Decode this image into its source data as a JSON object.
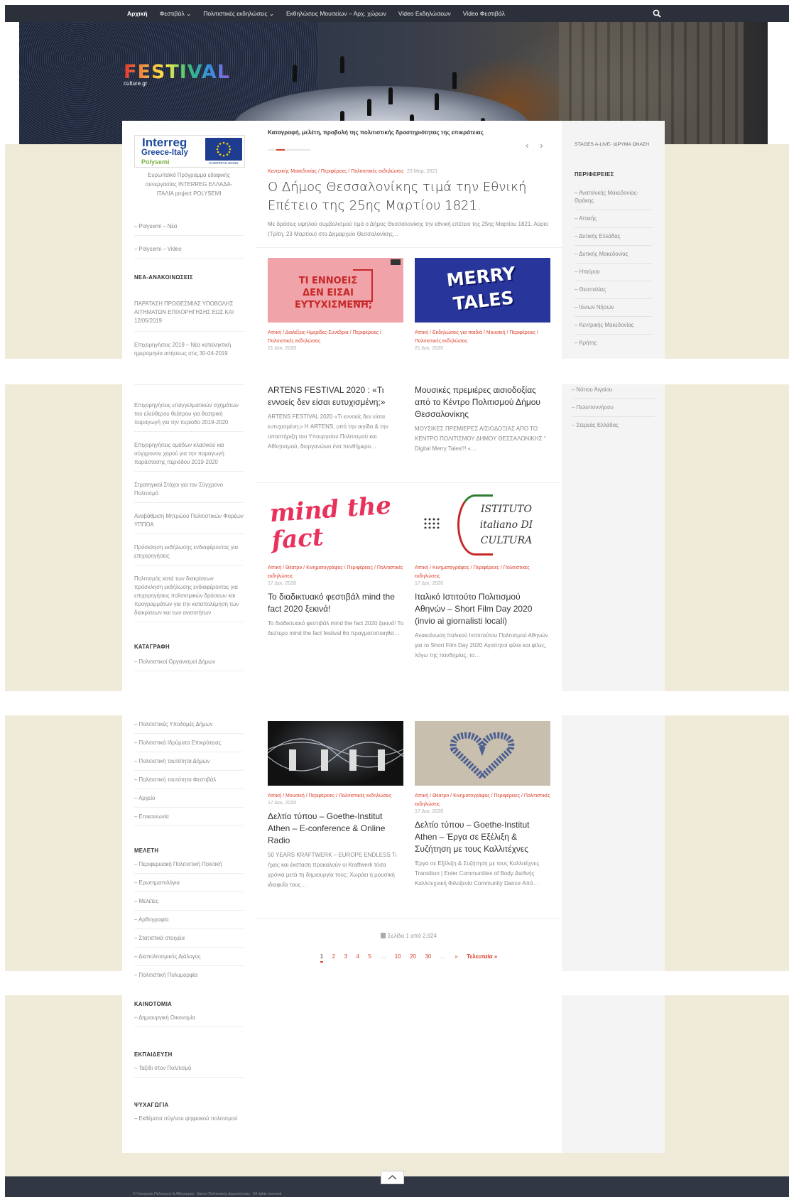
{
  "nav": {
    "items": [
      "Αρχική",
      "Φεστιβάλ ⌄",
      "Πολιτιστικές εκδηλώσεις ⌄",
      "Εκθηλώσεις Μουσείων – Αρχ. χώρων",
      "Video Εκδηλώσεων",
      "Video Φεστιβάλ"
    ]
  },
  "logo": {
    "title": "FESTIVAL",
    "sub": "culture.gr"
  },
  "tagline": "Καταγραφή, μελέτη, προβολή της πολιτιστικής δραστηριότητας της επικράτειας",
  "interreg": {
    "line1": "Interreg",
    "line2": "Greece-Italy",
    "line3": "Polysemi",
    "eu": "EUROPEAN UNION",
    "caption": "Ευρωπαϊκό Πρόγραμμα εδαφικής συνεργασίας INTERREG ΕΛΛΑΔΑ-ΙΤΑΛΙΑ project POLYSEMI"
  },
  "left": {
    "polysemi": [
      "– Polysemi – Νέα",
      "– Polysemi – Video"
    ],
    "news_heading": "ΝΕΑ-ΑΝΑΚΟΙΝΩΣΕΙΣ",
    "news_a": [
      "ΠΑΡΑΤΑΣΗ ΠΡΟΘΕΣΜΙΑΣ ΥΠΟΒΟΛΗΣ ΑΙΤΗΜΑΤΩΝ ΕΠΙΧΟΡΗΓΗΣΗΣ ΕΩΣ ΚΑΙ 12/05/2019",
      "Επιχορηγήσεις 2019 – Νέα καταληκτική ημερομηνία αιτήσεως στις 30-04-2019"
    ],
    "news_b": [
      "Επιχορηγήσεις επαγγελματικών σχημάτων του ελεύθερου θεάτρου για θεατρική παραγωγή για την περίοδο 2019-2020",
      "Επιχορηγήσεις ομάδων κλασικού και σύγχρονου χορού για την παραγωγή παράστασης περιόδου 2019-2020",
      "Στρατηγικοί Στόχοι για τον Σύγχρονο Πολιτισμό",
      "Αναβάθμιση Μητρώου Πολιτιστικών Φορέων ΥΠΠΟΑ",
      "Πρόσκληση εκδήλωσης ενδιαφέροντος για επιχορηγήσεις",
      "Πολιτισμός κατά των διακρίσεων πρόσκληση εκδήλωσης ενδιαφέροντος για επιχορηγήσεις πολιτισμικών δράσεων και προγραμμάτων για την καταπολέμηση των διακρίσεων και των ανισοτήτων"
    ],
    "katagrafi_heading": "ΚΑΤΑΓΡΑΦΗ",
    "katagrafi_a": [
      "– Πολιτιστικοί Οργανισμοί Δήμων"
    ],
    "katagrafi_b": [
      "– Πολιτιστικές Υποδομές Δήμων",
      "– Πολιτιστικά Ιδρύματα Επικράτειας",
      "– Πολιτιστική ταυτότητα Δήμων",
      "– Πολιτιστική ταυτότητα Φεστιβάλ",
      "– Αρχείο",
      "– Επικοινωνία"
    ],
    "meleti_heading": "ΜΕΛΕΤΗ",
    "meleti": [
      "– Περιφερειακή Πολιτιστική Πολιτική",
      "– Ερωτηματολόγια",
      "– Μελέτες",
      "– Αρθογραφία",
      "– Στατιστικά στοιχεία",
      "– Διαπολιτισμικός Διάλογος",
      "– Πολιτιστική Πολυμορφία"
    ],
    "kainotomia_heading": "ΚΑΙΝΟΤΟΜΙΑ",
    "kainotomia": [
      "– Δημιουργική Οικονομία"
    ],
    "ekpaideusi_heading": "ΕΚΠΑΙΔΕΥΣΗ",
    "ekpaideusi": [
      "– Ταξίδι στον Πολιτισμό"
    ],
    "psyxagogia_heading": "ΨΥΧΑΓΩΓΙΑ",
    "psyxagogia": [
      "– Εκθέματα σύγ/νου ψηφιακού πολιτισμού"
    ]
  },
  "right": {
    "stages": "STAGES A-LIVE- ΙΔΡΥΜΑ ΩΝΑΣΗ",
    "heading": "ΠΕΡΙΦΕΡΕΙΕΣ",
    "regions_a": [
      "– Ανατολικής Μακεδονίας-Θράκης",
      "– Αττικής",
      "– Δυτικής Ελλάδας",
      "– Δυτικής Μακεδονίας",
      "– Ηπείρου",
      "– Θεσσαλίας",
      "– Ιόνιων Νήσων",
      "– Κεντρικής Μακεδονίας",
      "– Κρήτης"
    ],
    "regions_b": [
      "– Νότιου Αιγαίου",
      "– Πελοποννήσου",
      "– Στερεάς Ελλάδας"
    ]
  },
  "featured": {
    "meta": "Κεντρικής Μακεδονίας / Περιφέρειες / Πολιτιστικές εκδηλώσεις",
    "date": "23 Μαρ, 2021",
    "title": "Ο Δήμος Θεσσαλονίκης τιμά την Εθνική Επέτειο της 25ης Μαρτίου 1821.",
    "excerpt": "Με δράσεις υψηλού συμβολισμού τιμά ο Δήμος Θεσσαλονίκης την εθνική επέτειο της 25ης Μαρτίου 1821. Αύριο (Τρίτη, 23 Μαρτίου) στο Δημαρχείο Θεσσαλονίκης…"
  },
  "posts": [
    {
      "meta": "Αττική / Διαλέξεις-Ημερίδες-Συνέδρια / Περιφέρειες / Πολιτιστικές εκδηλώσεις",
      "date": "21 Δεκ, 2020",
      "img_text": "ΤΙ ΕΝΝΟΕΙΣ ΔΕΝ ΕΙΣΑΙ ΕΥΤΥΧΙΣΜΕΝΗ;",
      "title": "ARTENS FESTIVAL 2020 : «Τι εννοείς δεν είσαι ευτυχισμένη;»",
      "excerpt": "ARTENS FESTIVAL 2020 «Τι εννοείς δεν είσαι ευτυχισμένη;» Η ARTENS, υπό την αιγίδα & την υποστήριξη του Υπουργείου Πολιτισμού και Αθλητισμού, διοργανώνει ένα πενθήμερο…"
    },
    {
      "meta": "Αττική / Εκδηλώσεις για παιδιά / Μουσική / Περιφέρειες / Πολιτιστικές εκδηλώσεις",
      "date": "21 Δεκ, 2020",
      "img_text": "MERRY TALES",
      "title": "Μουσικές πρεμιέρες αισιοδοξίας από το Κέντρο Πολιτισμού Δήμου Θεσσαλονίκης",
      "excerpt": "ΜΟΥΣΙΚΕΣ ΠΡΕΜΙΕΡΕΣ ΑΙΣΙΟΔΟΞΙΑΣ ΑΠΟ ΤΟ ΚΕΝΤΡΟ ΠΟΛΙΤΙΣΜΟΥ ΔΗΜΟΥ ΘΕΣΣΑΛΟΝΙΚΗΣ “ Digital Merry Tales!!! «…"
    },
    {
      "meta": "Αττική / Θέατρο / Κινηματογράφος / Περιφέρειες / Πολιτιστικές εκδηλώσεις",
      "date": "17 Δεκ, 2020",
      "img_text": "mind the fact",
      "title": "Το διαδικτυακό φεστιβάλ mind the fact 2020 ξεκινά!",
      "excerpt": "Το διαδικτυακό φεστιβάλ mind the fact 2020 ξεκινά! Το δεύτερο mind the fact festival θα πραγματοποιηθεί…"
    },
    {
      "meta": "Αττική / Κινηματογράφος / Περιφέρειες / Πολιτιστικές εκδηλώσεις",
      "date": "17 Δεκ, 2020",
      "img_text": "ISTITUTO italiano DI CULTURA",
      "title": "Ιταλικό Ιστιτούτο Πολιτισμού Αθηνών – Short Film Day 2020 (invio ai giornalisti locali)",
      "excerpt": "Ανακοίνωση Ιταλικού Ινστιτούτου Πολιτισμού Αθηνών για το Short Film Day 2020 Αγαπητοί φίλοι και φίλες, λόγω της πανδημίας, το…"
    },
    {
      "meta": "Αττική / Μουσική / Περιφέρειες / Πολιτιστικές εκδηλώσεις",
      "date": "17 Δεκ, 2020",
      "img_text": "",
      "title": "Δελτίο τύπου – Goethe-Institut Athen – E-conference & Online Radio",
      "excerpt": "50 YEARS KRAFTWERK – EUROPE ENDLESS Τι ήχος και έκσταση προκαλούν οι Kraftwerk τόσα χρόνια μετά τη δημιουργία τους; Χωράει η μουσική ιδιοφυΐα τους…"
    },
    {
      "meta": "Αττική / Θέατρο / Κινηματογράφος / Περιφέρειες / Πολιτιστικές εκδηλώσεις",
      "date": "17 Δεκ, 2020",
      "img_text": "",
      "title": "Δελτίο τύπου – Goethe-Institut Athen – Έργα σε Εξέλιξη & Συζήτηση με τους Καλλιτέχνες",
      "excerpt": "Έργα σε Εξέλιξη & Συζήτηση με τους Καλλιτέχνες Transition | Enter Communities of Body Διεθνής Καλλιτεχνική Φιλοξενία Community Dance Από…"
    }
  ],
  "pagination": {
    "summary": "Σελίδα 1 από 2.924",
    "pages": [
      "1",
      "2",
      "3",
      "4",
      "5",
      "…",
      "10",
      "20",
      "30",
      "…",
      "»",
      "Τελευταία »"
    ]
  },
  "footer": {
    "text": "© Υπουργείο Πολιτισμού & Αθλητισμού - Δίκτυο Πολιτιστικής Δημοσιότητας - All rights reserved"
  },
  "colors": {
    "accent": "#d9412e",
    "nav_bg": "#2b303b",
    "band": "#f0ebd9"
  }
}
